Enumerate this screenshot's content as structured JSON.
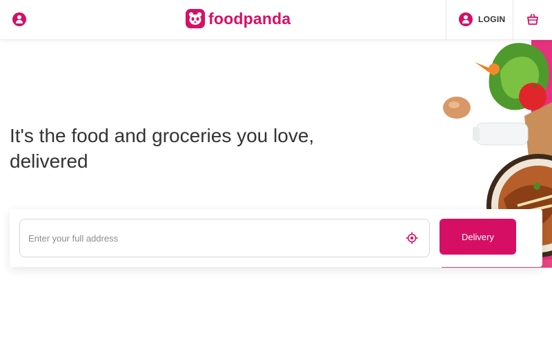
{
  "header": {
    "brand_name": "foodpanda",
    "login_label": "LOGIN",
    "icons": {
      "profile": "user-circle-icon",
      "brand": "panda-logo-icon",
      "login": "user-circle-icon",
      "cart": "shopping-bag-icon"
    }
  },
  "hero": {
    "title": "It's the food and groceries you love, delivered"
  },
  "search": {
    "address_placeholder": "Enter your full address",
    "address_value": "",
    "locate_icon": "crosshair-location-icon",
    "delivery_label": "Delivery"
  },
  "colors": {
    "brand_pink": "#d70f64",
    "text_dark": "#333333",
    "border": "#d6d6d6"
  }
}
